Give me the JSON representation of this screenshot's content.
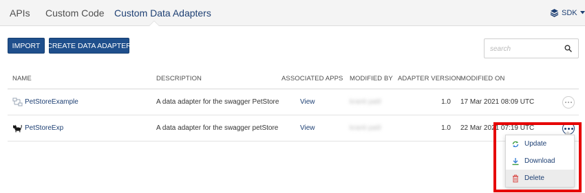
{
  "tabs": [
    {
      "label": "APIs"
    },
    {
      "label": "Custom Code"
    },
    {
      "label": "Custom Data Adapters"
    }
  ],
  "sdk": {
    "label": "SDK"
  },
  "actions": {
    "import_label": "IMPORT",
    "create_label": "CREATE DATA ADAPTER"
  },
  "search": {
    "placeholder": "search",
    "value": ""
  },
  "table": {
    "headers": [
      "NAME",
      "DESCRIPTION",
      "ASSOCIATED APPS",
      "MODIFIED BY",
      "ADAPTER VERSION",
      "MODIFIED ON"
    ],
    "rows": [
      {
        "icon": "swagger-icon",
        "name": "PetStoreExample",
        "description": "A data adapter for the swagger PetStore",
        "apps": "View",
        "modified_by": "kranti patil",
        "version": "1.0",
        "modified_on": "17 Mar 2021 08:09 UTC"
      },
      {
        "icon": "cat-icon",
        "name": "PetStoreExp",
        "description": "A data adapter for the swagger petStore",
        "apps": "View",
        "modified_by": "kranti patil",
        "version": "1.0",
        "modified_on": "22 Mar 2021 07:19 UTC"
      }
    ]
  },
  "menu": {
    "items": [
      {
        "label": "Update",
        "icon": "update-icon"
      },
      {
        "label": "Download",
        "icon": "download-icon"
      },
      {
        "label": "Delete",
        "icon": "delete-icon"
      }
    ]
  },
  "colors": {
    "accent": "#1f4f8c",
    "link": "#1d3f73",
    "highlight": "#e60000"
  }
}
